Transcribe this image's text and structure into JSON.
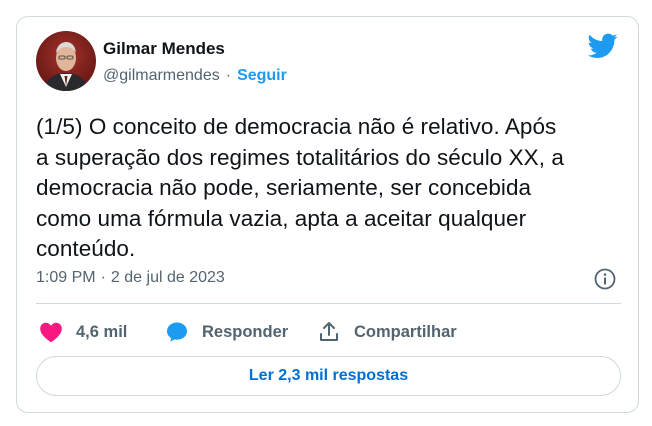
{
  "author": {
    "name": "Gilmar Mendes",
    "handle": "@gilmarmendes",
    "separator": "·",
    "follow_label": "Seguir"
  },
  "tweet": {
    "lines": [
      "(1/5) O conceito de democracia não é relativo. Após",
      "a superação dos regimes totalitários do século XX, a",
      "democracia não pode, seriamente, ser concebida",
      "como uma fórmula vazia, apta a aceitar qualquer",
      "conteúdo."
    ],
    "time": "1:09 PM",
    "time_separator": "·",
    "date": "2 de jul de 2023"
  },
  "actions": {
    "likes": "4,6 mil",
    "reply_label": "Responder",
    "share_label": "Compartilhar"
  },
  "replies_button_label": "Ler 2,3 mil respostas",
  "icons": {
    "logo": "twitter-bird-icon",
    "info": "info-icon",
    "like": "heart-icon",
    "reply": "speech-bubble-icon",
    "share": "share-upload-icon"
  },
  "colors": {
    "brand": "#1d9bf0",
    "heart": "#f91880",
    "link": "#006fd6",
    "muted": "#536471",
    "text": "#0f1419"
  }
}
